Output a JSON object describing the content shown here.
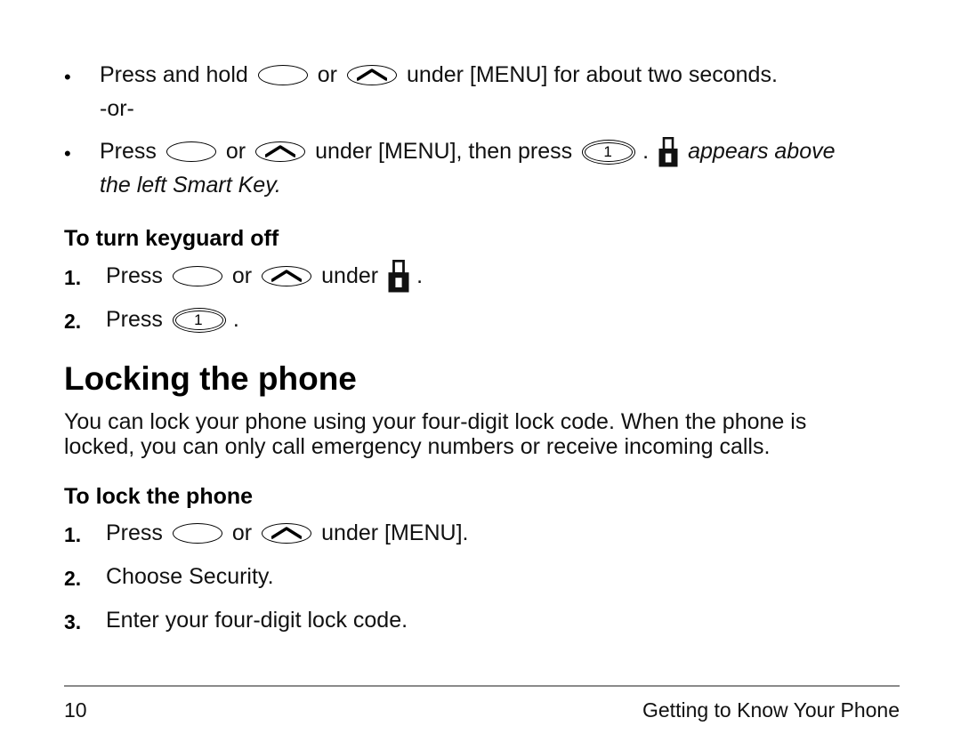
{
  "page": {
    "background": "#ffffff",
    "text_color": "#111111"
  },
  "icons": {
    "oval_key": "rounded-key-icon",
    "chevron_key": "up-chevron-key-icon",
    "one_key": "number-one-key-icon",
    "lock": "padlock-icon"
  },
  "bullets": [
    {
      "marker": "•",
      "line1_pre": "Press and hold",
      "line1_mid": "or",
      "line1_post": "under [MENU] for about two seconds.",
      "line2": "-or-"
    },
    {
      "marker": "•",
      "line1_pre": "Press",
      "line1_mid": "or",
      "line1_post": "under [MENU], then press",
      "line1_period": ".",
      "line1_italic": "appears above",
      "line2_italic": "the left Smart Key."
    }
  ],
  "sections": [
    {
      "heading": "To turn keyguard off",
      "steps": [
        {
          "number": "1.",
          "pre": "Press",
          "mid": "or",
          "post": "under",
          "period": "."
        },
        {
          "number": "2.",
          "pre": "Press",
          "period": "."
        }
      ]
    },
    {
      "heading": "Locking the phone",
      "body_line1": "You can lock your phone using your four-digit lock code. When the phone is",
      "body_line2": "locked, you can only call emergency numbers or receive incoming calls."
    },
    {
      "heading": "To lock the phone",
      "steps": [
        {
          "number": "1.",
          "pre": "Press",
          "mid": "or",
          "post": "under [MENU]."
        },
        {
          "number": "2.",
          "text": "Choose Security."
        },
        {
          "number": "3.",
          "text": "Enter your four-digit lock code."
        }
      ]
    }
  ],
  "footer": {
    "page_number": "10",
    "section_title": "Getting to Know Your Phone",
    "rule_color": "#8a8a8a"
  }
}
